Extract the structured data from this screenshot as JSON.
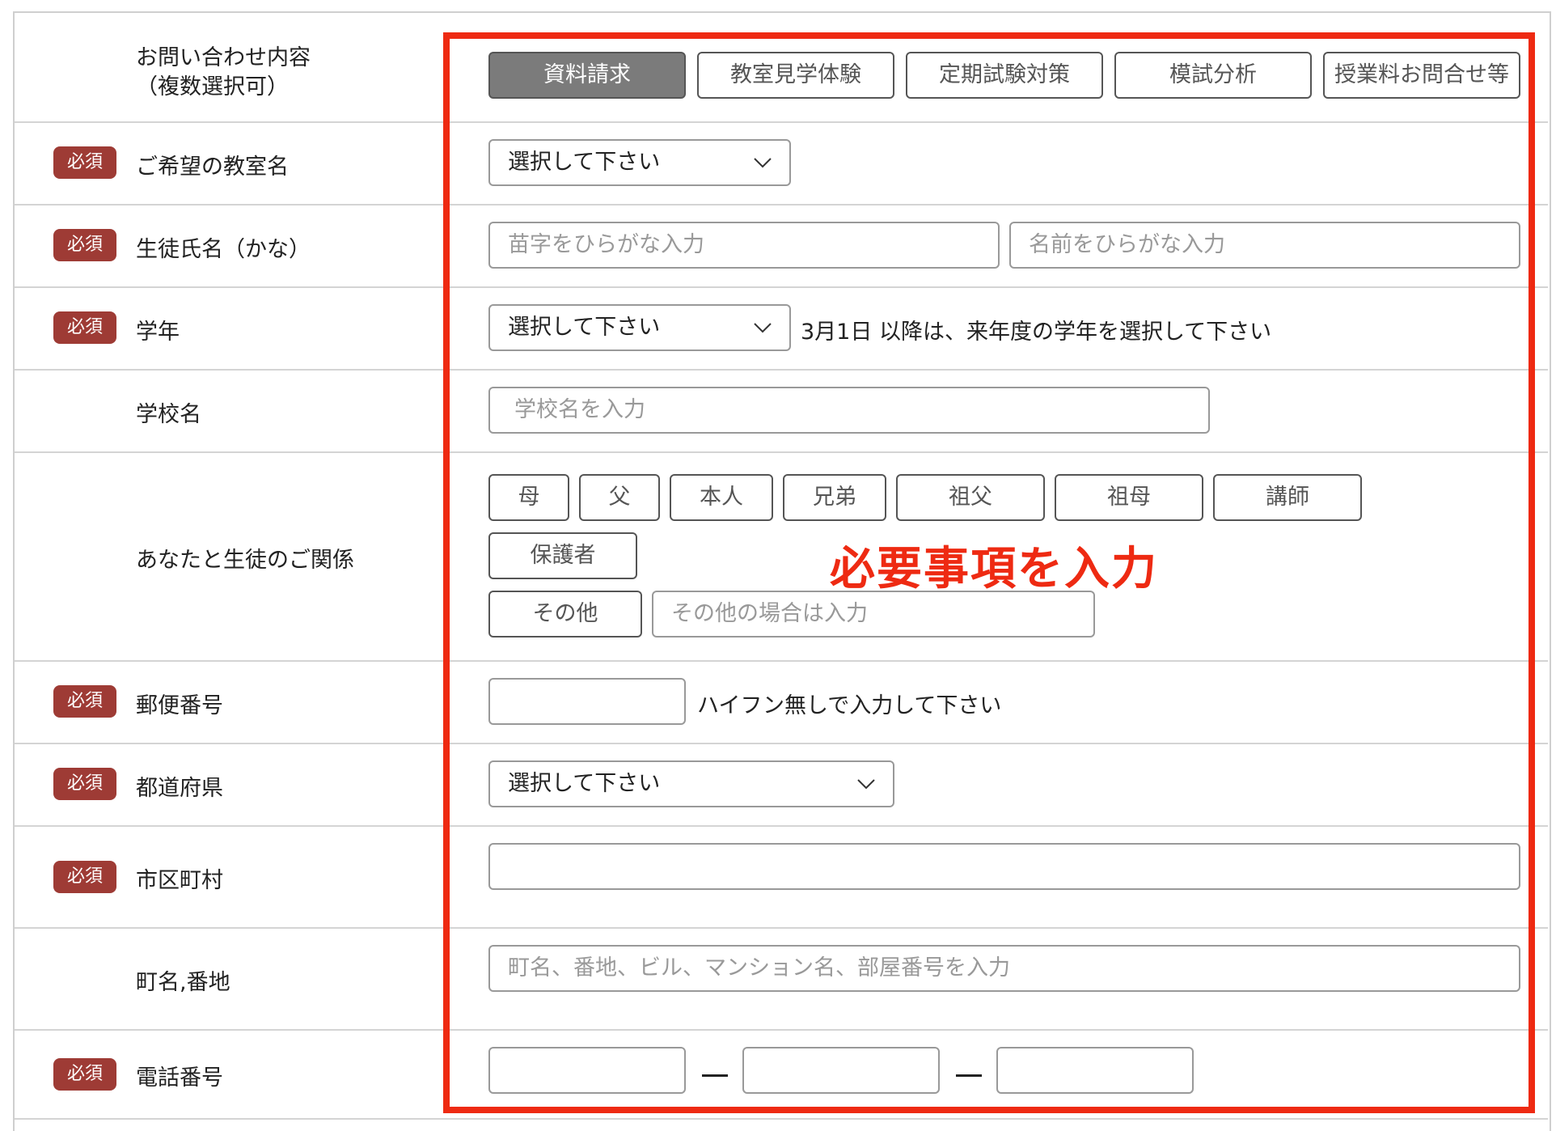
{
  "required_label": "必須",
  "rows": {
    "inquiry": {
      "label_line1": "お問い合わせ内容",
      "label_line2": "（複数選択可）",
      "options": [
        "資料請求",
        "教室見学体験",
        "定期試験対策",
        "模試分析",
        "授業料お問合せ等"
      ],
      "selected": "資料請求"
    },
    "classroom": {
      "label": "ご希望の教室名",
      "select_value": "選択して下さい"
    },
    "student_name": {
      "label": "生徒氏名（かな）",
      "surname_placeholder": "苗字をひらがな入力",
      "given_placeholder": "名前をひらがな入力"
    },
    "grade": {
      "label": "学年",
      "select_value": "選択して下さい",
      "hint": "3月1日 以降は、来年度の学年を選択して下さい"
    },
    "school": {
      "label": "学校名",
      "placeholder": "学校名を入力"
    },
    "relation": {
      "label": "あなたと生徒のご関係",
      "options": [
        "母",
        "父",
        "本人",
        "兄弟",
        "祖父",
        "祖母",
        "講師",
        "保護者",
        "その他"
      ],
      "other_placeholder": "その他の場合は入力"
    },
    "postal": {
      "label": "郵便番号",
      "hint": "ハイフン無しで入力して下さい"
    },
    "prefecture": {
      "label": "都道府県",
      "select_value": "選択して下さい"
    },
    "city": {
      "label": "市区町村"
    },
    "address": {
      "label": "町名,番地",
      "placeholder": "町名、番地、ビル、マンション名、部屋番号を入力"
    },
    "phone": {
      "label": "電話番号"
    }
  },
  "annotation": {
    "text": "必要事項を入力",
    "color": "#ee2a12"
  },
  "colors": {
    "required_badge": "#9e3b35",
    "selected_button": "#7b7b7b"
  }
}
